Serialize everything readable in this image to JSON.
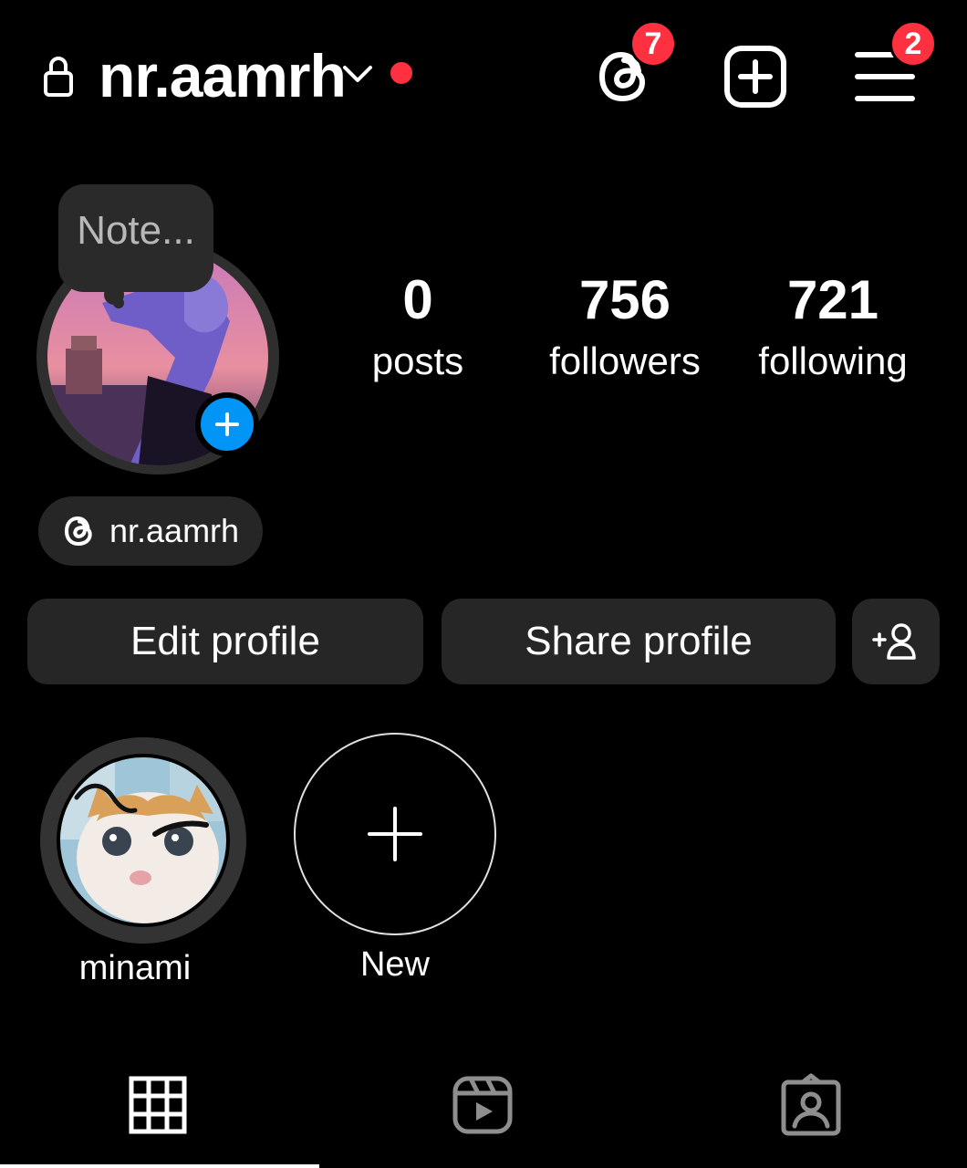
{
  "header": {
    "username": "nr.aamrh",
    "threads_badge": "7",
    "menu_badge": "2"
  },
  "profile": {
    "note_placeholder": "Note...",
    "threads_handle": "nr.aamrh"
  },
  "stats": {
    "posts": {
      "value": "0",
      "label": "posts"
    },
    "followers": {
      "value": "756",
      "label": "followers"
    },
    "following": {
      "value": "721",
      "label": "following"
    }
  },
  "actions": {
    "edit_label": "Edit profile",
    "share_label": "Share profile"
  },
  "highlights": [
    {
      "label": "minami"
    },
    {
      "label": "New"
    }
  ],
  "tabs": [
    "grid-icon",
    "reels-icon",
    "tagged-icon"
  ],
  "colors": {
    "background": "#000000",
    "badge": "#ff3040",
    "accent_blue": "#0095f6",
    "button_bg": "#262626"
  }
}
